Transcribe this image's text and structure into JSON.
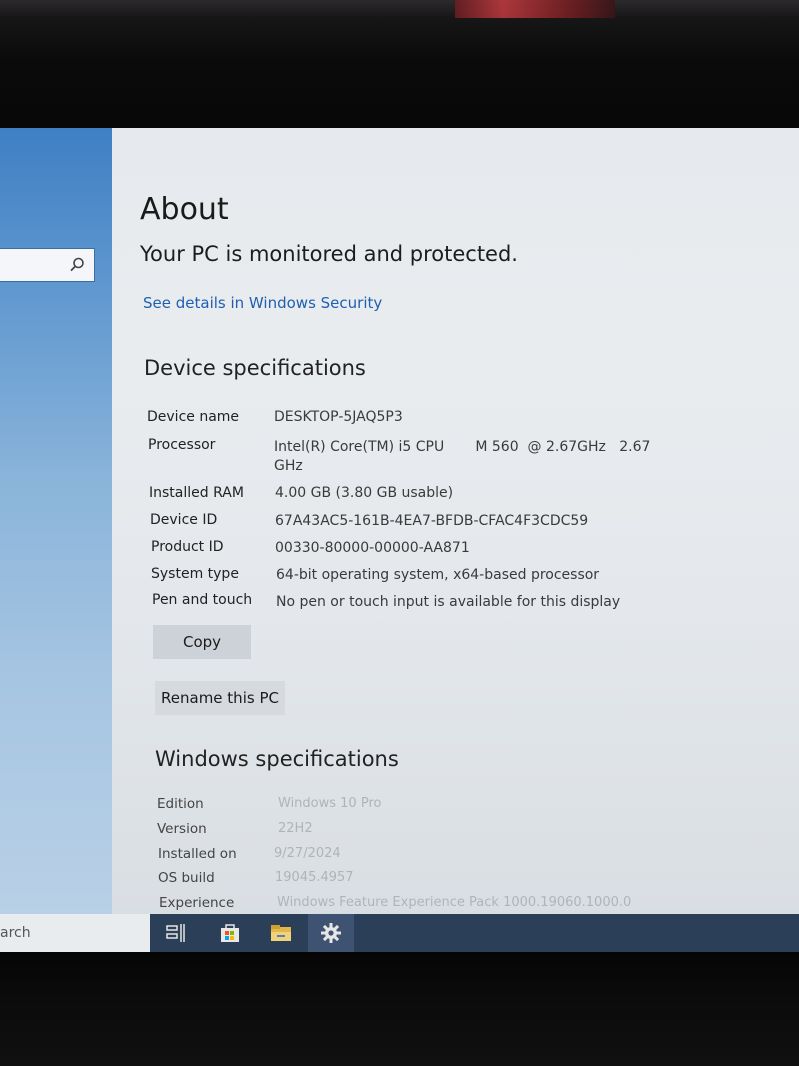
{
  "window": {
    "title": "About",
    "security_status": "Your PC is monitored and protected.",
    "security_link": "See details in Windows Security"
  },
  "device_specs": {
    "heading": "Device specifications",
    "rows": [
      {
        "label": "Device name",
        "value": "DESKTOP-5JAQ5P3"
      },
      {
        "label": "Processor",
        "value": "Intel(R) Core(TM) i5 CPU       M 560  @ 2.67GHz   2.67",
        "value2": "GHz"
      },
      {
        "label": "Installed RAM",
        "value": "4.00 GB (3.80 GB usable)"
      },
      {
        "label": "Device ID",
        "value": "67A43AC5-161B-4EA7-BFDB-CFAC4F3CDC59"
      },
      {
        "label": "Product ID",
        "value": "00330-80000-00000-AA871"
      },
      {
        "label": "System type",
        "value": "64-bit operating system, x64-based processor"
      },
      {
        "label": "Pen and touch",
        "value": "No pen or touch input is available for this display"
      }
    ],
    "copy_label": "Copy",
    "rename_label": "Rename this PC"
  },
  "windows_specs": {
    "heading": "Windows specifications",
    "rows": [
      {
        "label": "Edition",
        "value": "Windows 10 Pro"
      },
      {
        "label": "Version",
        "value": "22H2"
      },
      {
        "label": "Installed on",
        "value": "9/27/2024"
      },
      {
        "label": "OS build",
        "value": "19045.4957"
      },
      {
        "label": "Experience",
        "value": "Windows Feature Experience Pack 1000.19060.1000.0"
      }
    ]
  },
  "taskbar": {
    "search_text": "arch",
    "icons": [
      "task-view-icon",
      "store-icon",
      "file-explorer-icon",
      "settings-icon"
    ]
  },
  "colors": {
    "link": "#1e5fb0",
    "taskbar": "#2b3f59",
    "sidebar_top": "#3f7fc4"
  }
}
